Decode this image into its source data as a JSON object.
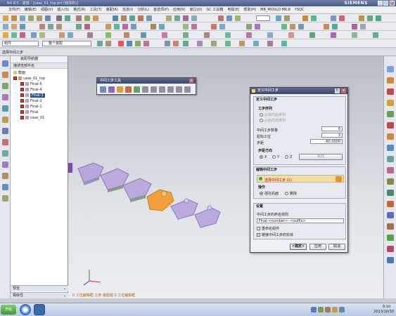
{
  "window": {
    "title": "NX 8.5 - 建模 - [case_01_top.prt (修改的)]",
    "brand": "SIEMENS"
  },
  "menu": [
    "文件(F)",
    "编辑(E)",
    "视图(V)",
    "插入(S)",
    "格式(R)",
    "工具(T)",
    "装配(A)",
    "信息(I)",
    "分析(L)",
    "首选项(P)",
    "应用(N)",
    "窗口(O)",
    "GC 工具箱",
    "电极(E)",
    "帮助(H)",
    "MB_MOULD M6.8",
    "YSQC"
  ],
  "toolbar": {
    "filter_value": "组件",
    "scope_value": "整个装配"
  },
  "graphics": {
    "header": "选择中间工步"
  },
  "navigator": {
    "title": "装配导航器",
    "column": "描述性部件名",
    "items": [
      {
        "label": "截面",
        "kind": "folder",
        "indent": 0,
        "checked": false
      },
      {
        "label": "case_01_top",
        "kind": "assembly",
        "indent": 0,
        "checked": true
      },
      {
        "label": "Final-5",
        "kind": "part",
        "indent": 1,
        "checked": true
      },
      {
        "label": "Final-4",
        "kind": "part",
        "indent": 1,
        "checked": true
      },
      {
        "label": "Final-3",
        "kind": "part",
        "indent": 1,
        "checked": true,
        "selected": true
      },
      {
        "label": "Final-2",
        "kind": "part",
        "indent": 1,
        "checked": true
      },
      {
        "label": "Final-1",
        "kind": "part",
        "indent": 1,
        "checked": true
      },
      {
        "label": "Final",
        "kind": "part",
        "indent": 1,
        "checked": true
      },
      {
        "label": "case_01",
        "kind": "part",
        "indent": 1,
        "checked": true
      }
    ],
    "preview": "预览",
    "dependencies": "相依性"
  },
  "mid_toolbar": {
    "title": "中间工步工具"
  },
  "dialog": {
    "title": "定义中间工步",
    "tab": "定义中间工步",
    "group_sequence": "工步序列",
    "radio_seq1": "从前向后排列",
    "radio_seq2": "从后向前排列",
    "lbl_count": "中间工步数量",
    "val_count": "6",
    "lbl_start": "起始工位",
    "val_start": "3",
    "lbl_step": "步距",
    "val_step": "-80.0000",
    "group_direction": "步距方向",
    "dir_x": "X",
    "dir_y": "Y",
    "dir_z": "Z",
    "reverse_btn": "反向",
    "edit_title": "编辑中间工步",
    "select_step": "选择中间工步 (1)",
    "operation": "操作",
    "op_insert": "插在后面",
    "op_delete": "删除",
    "settings": "设置",
    "naming_label": "中间工步的命名规则",
    "naming_rule": "Final-<number>--<suffix>",
    "rename_comp": "重命名组件",
    "link_body": "链接中间工步的实体",
    "ok": "<确定>",
    "apply": "应用",
    "cancel": "取消"
  },
  "status": {
    "text": "0 工位编辑框 工步 装配组 0 工位编辑框"
  },
  "taskbar": {
    "start": "开始",
    "time": "9:10",
    "date": "2013/10/30"
  }
}
